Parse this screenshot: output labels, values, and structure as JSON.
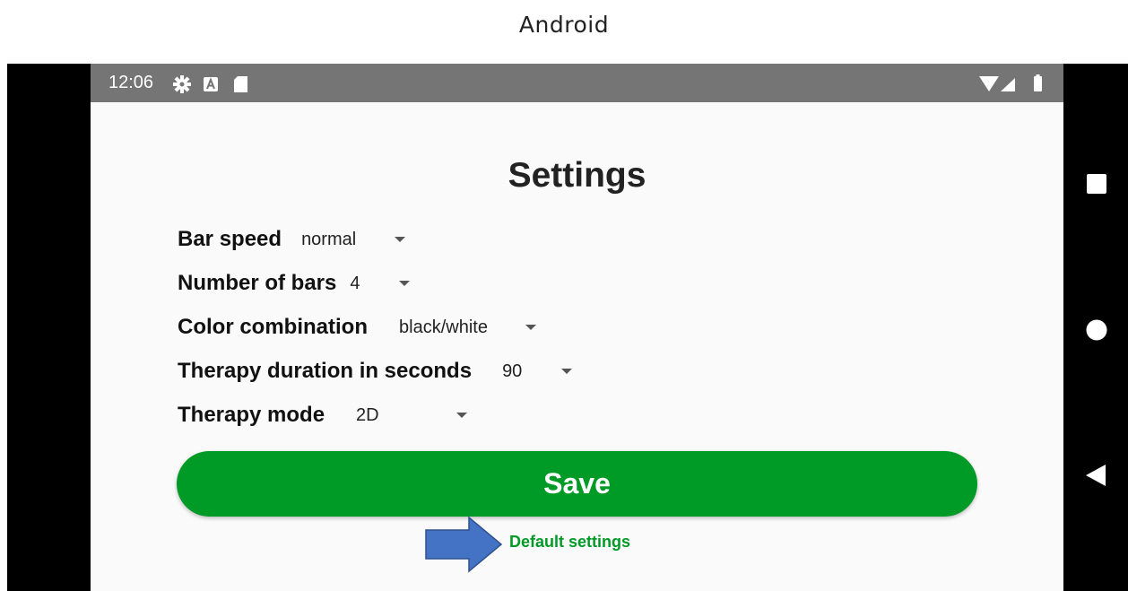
{
  "caption": "Android",
  "status_bar": {
    "time": "12:06",
    "icons": [
      "gear-icon",
      "a-icon",
      "sd-card-icon",
      "wifi-icon",
      "signal-icon",
      "battery-icon"
    ]
  },
  "settings": {
    "title": "Settings",
    "rows": [
      {
        "label": "Bar speed",
        "value": "normal"
      },
      {
        "label": "Number of bars",
        "value": "4"
      },
      {
        "label": "Color combination",
        "value": "black/white"
      },
      {
        "label": "Therapy duration in seconds",
        "value": "90"
      },
      {
        "label": "Therapy mode",
        "value": "2D"
      }
    ],
    "save_label": "Save",
    "default_link": "Default settings"
  },
  "nav_bar": {
    "icons": [
      "recents-icon",
      "home-icon",
      "back-icon"
    ]
  },
  "colors": {
    "accent": "#009a26",
    "status_bar": "#757575",
    "annotation_arrow": "#4472c4"
  }
}
